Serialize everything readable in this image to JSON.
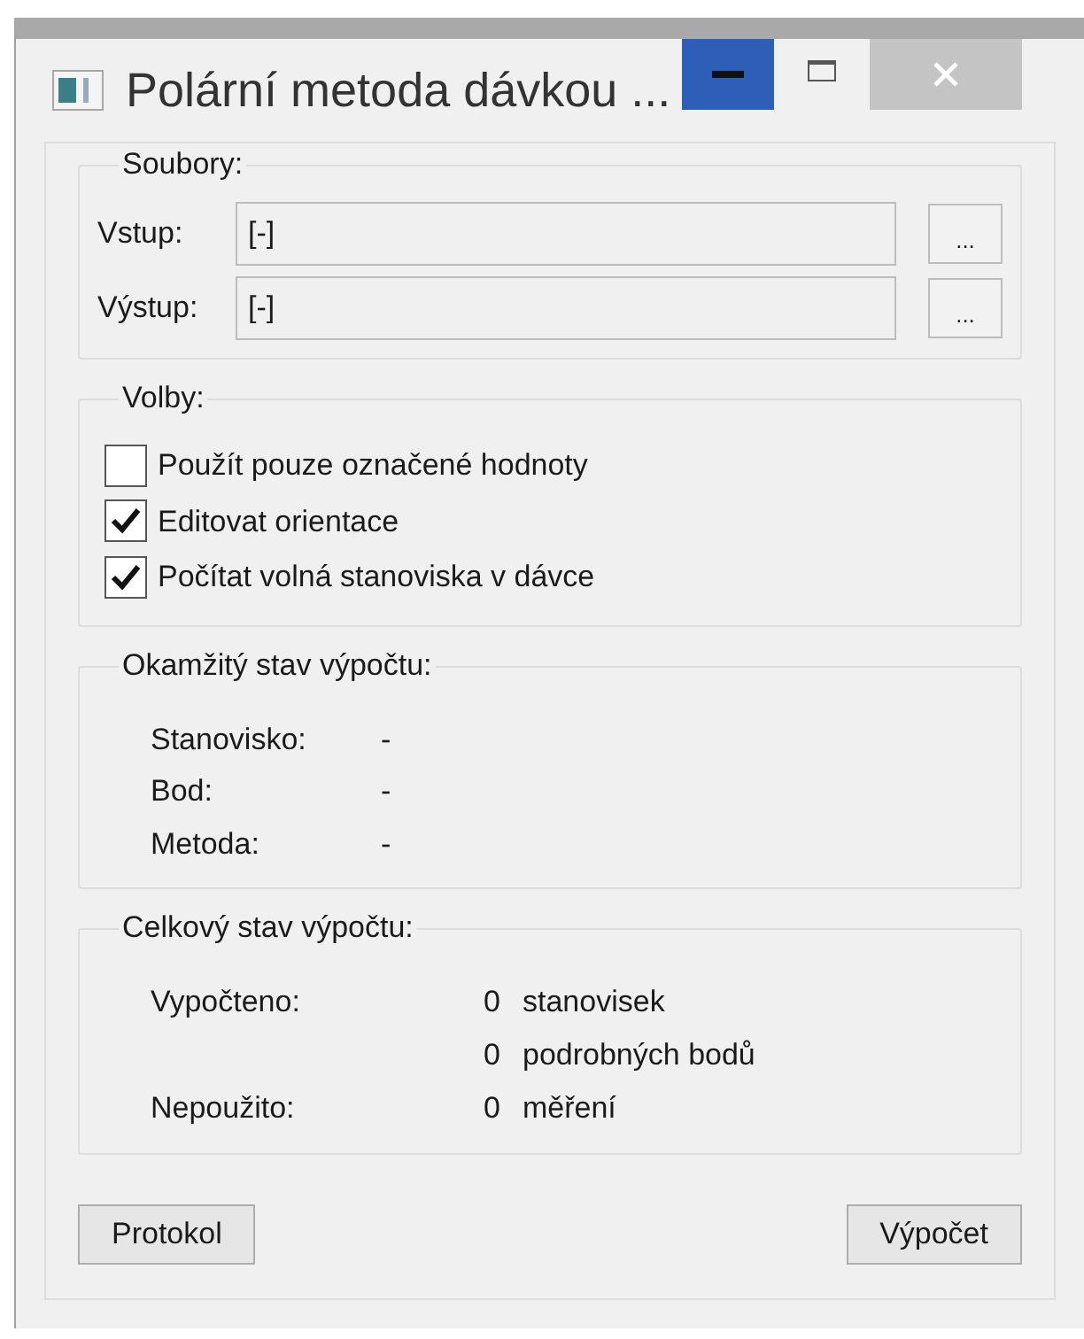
{
  "window": {
    "title": "Polární metoda dávkou ..."
  },
  "files": {
    "title": "Soubory:",
    "rows": [
      {
        "label": "Vstup:",
        "value": "[-]",
        "button": "..."
      },
      {
        "label": "Výstup:",
        "value": "[-]",
        "button": "..."
      }
    ]
  },
  "options": {
    "title": "Volby:",
    "items": [
      {
        "label": "Použít pouze označené hodnoty",
        "checked": false
      },
      {
        "label": "Editovat orientace",
        "checked": true
      },
      {
        "label": "Počítat volná stanoviska v dávce",
        "checked": true
      }
    ]
  },
  "current": {
    "title": "Okamžitý stav výpočtu:",
    "rows": [
      {
        "label": "Stanovisko:",
        "value": "-"
      },
      {
        "label": "Bod:",
        "value": "-"
      },
      {
        "label": "Metoda:",
        "value": "-"
      }
    ]
  },
  "total": {
    "title": "Celkový stav výpočtu:",
    "rows": [
      {
        "label": "Vypočteno:",
        "count": "0",
        "unit": "stanovisek"
      },
      {
        "label": "",
        "count": "0",
        "unit": "podrobných bodů"
      },
      {
        "label": "Nepoužito:",
        "count": "0",
        "unit": "měření"
      }
    ]
  },
  "buttons": [
    "Protokol",
    "Výpočet"
  ]
}
